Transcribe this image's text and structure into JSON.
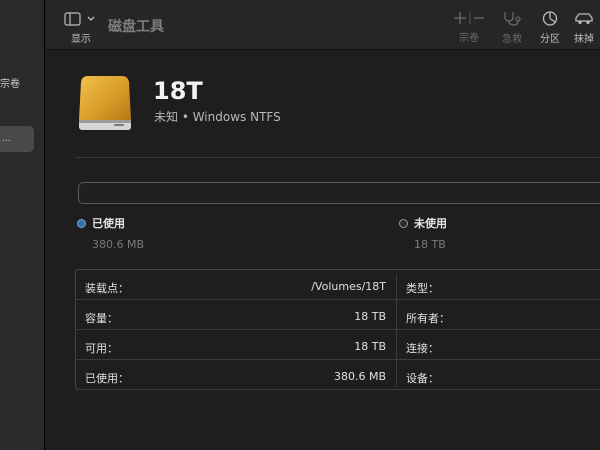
{
  "sidebar": {
    "section_label": "宗卷",
    "selected_item_label": "..."
  },
  "toolbar": {
    "view_label": "显示",
    "app_title": "磁盘工具",
    "volume_label": "宗卷",
    "firstaid_label": "急救",
    "partition_label": "分区",
    "erase_label": "抹掉"
  },
  "disk": {
    "name": "18T",
    "subtitle": "未知 • Windows NTFS"
  },
  "usage": {
    "used_fraction": 2e-05,
    "used_label": "已使用",
    "used_value": "380.6 MB",
    "free_label": "未使用",
    "free_value": "18 TB",
    "used_color": "#3a6ea8",
    "free_color": "#2a2a2a"
  },
  "info": {
    "rows": [
      {
        "label": "装载点：",
        "value": "/Volumes/18T",
        "label2": "类型："
      },
      {
        "label": "容量：",
        "value": "18 TB",
        "label2": "所有者："
      },
      {
        "label": "可用：",
        "value": "18 TB",
        "label2": "连接："
      },
      {
        "label": "已使用：",
        "value": "380.6 MB",
        "label2": "设备："
      }
    ]
  }
}
